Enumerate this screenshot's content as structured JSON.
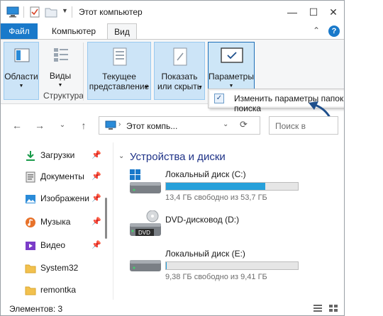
{
  "window": {
    "title": "Этот компьютер",
    "controls": {
      "minimize": "—",
      "maximize": "☐",
      "close": "✕"
    }
  },
  "ribbon": {
    "tabs": [
      {
        "label": "Файл"
      },
      {
        "label": "Компьютер"
      },
      {
        "label": "Вид"
      }
    ],
    "collapse_icon": "⌃",
    "help_icon": "?",
    "buttons": {
      "panes": "Области",
      "layout": "Виды",
      "current_view_line1": "Текущее",
      "current_view_line2": "представление",
      "show_hide_line1": "Показать",
      "show_hide_line2": "или скрыть",
      "options": "Параметры"
    },
    "group_structure": "Структура"
  },
  "dropdown": {
    "item": "Изменить параметры папок и поиска"
  },
  "address": {
    "path": "Этот компь...",
    "search_placeholder": "Поиск в"
  },
  "sidebar": {
    "items": [
      {
        "label": "Загрузки",
        "icon": "download-icon",
        "pinned": true
      },
      {
        "label": "Документы",
        "icon": "documents-icon",
        "pinned": true
      },
      {
        "label": "Изображени",
        "icon": "pictures-icon",
        "pinned": true
      },
      {
        "label": "Музыка",
        "icon": "music-icon",
        "pinned": true
      },
      {
        "label": "Видео",
        "icon": "video-icon",
        "pinned": true
      },
      {
        "label": "System32",
        "icon": "folder-icon",
        "pinned": false
      },
      {
        "label": "remontka",
        "icon": "folder-icon",
        "pinned": false
      }
    ]
  },
  "content": {
    "section_title": "Устройства и диски",
    "drives": [
      {
        "name": "Локальный диск (C:)",
        "free": "13,4 ГБ свободно из 53,7 ГБ",
        "used_fraction": 0.75
      },
      {
        "name": "DVD-дисковод (D:)",
        "badge": "DVD"
      },
      {
        "name": "Локальный диск (E:)",
        "free": "9,38 ГБ свободно из 9,41 ГБ",
        "used_fraction": 0.003
      }
    ]
  },
  "status": {
    "items": "Элементов: 3"
  },
  "colors": {
    "accent": "#1979ca",
    "bar": "#26a0da",
    "arrow": "#1e4f8c",
    "highlight": "#cce4f7"
  }
}
